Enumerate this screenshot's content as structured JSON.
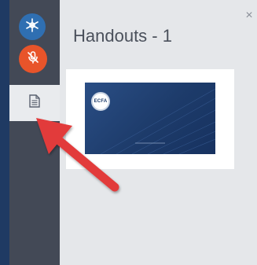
{
  "panel": {
    "title": "Handouts - 1",
    "close_symbol": "×"
  },
  "slide": {
    "logo_text": "ECFA"
  },
  "icons": {
    "app": "snowflake-icon",
    "mic": "mic-off-icon",
    "handouts": "document-icon",
    "close": "close-icon"
  },
  "colors": {
    "sidebar": "#434956",
    "mic_button": "#e8542a",
    "app_button": "#2f6fb2",
    "panel": "#e5e7ea",
    "arrow": "#e23b3b",
    "slide": "#1d3b6a"
  }
}
